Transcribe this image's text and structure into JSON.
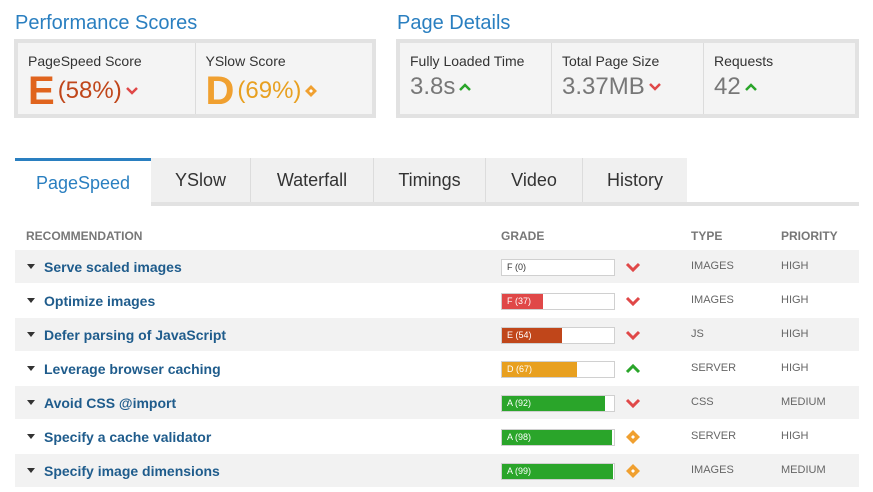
{
  "performance": {
    "title": "Performance Scores",
    "pagespeed": {
      "label": "PageSpeed Score",
      "grade": "E",
      "pct": "(58%)",
      "color": "#e0641e",
      "trend": "down"
    },
    "yslow": {
      "label": "YSlow Score",
      "grade": "D",
      "pct": "(69%)",
      "color": "#f0a030",
      "trend": "neutral"
    }
  },
  "details": {
    "title": "Page Details",
    "load_time": {
      "label": "Fully Loaded Time",
      "value": "3.8s",
      "trend": "up"
    },
    "page_size": {
      "label": "Total Page Size",
      "value": "3.37MB",
      "trend": "down"
    },
    "requests": {
      "label": "Requests",
      "value": "42",
      "trend": "up"
    }
  },
  "tabs": [
    "PageSpeed",
    "YSlow",
    "Waterfall",
    "Timings",
    "Video",
    "History"
  ],
  "active_tab": 0,
  "table": {
    "headers": {
      "recommendation": "RECOMMENDATION",
      "grade": "GRADE",
      "type": "TYPE",
      "priority": "PRIORITY"
    },
    "rows": [
      {
        "name": "Serve scaled images",
        "grade": "F (0)",
        "score": 0,
        "color": "#ffffff",
        "trend": "down",
        "type": "IMAGES",
        "priority": "HIGH"
      },
      {
        "name": "Optimize images",
        "grade": "F (37)",
        "score": 37,
        "color": "#e04848",
        "trend": "down",
        "type": "IMAGES",
        "priority": "HIGH"
      },
      {
        "name": "Defer parsing of JavaScript",
        "grade": "E (54)",
        "score": 54,
        "color": "#c0461a",
        "trend": "down",
        "type": "JS",
        "priority": "HIGH"
      },
      {
        "name": "Leverage browser caching",
        "grade": "D (67)",
        "score": 67,
        "color": "#e8a020",
        "trend": "up",
        "type": "SERVER",
        "priority": "HIGH"
      },
      {
        "name": "Avoid CSS @import",
        "grade": "A (92)",
        "score": 92,
        "color": "#2aa52a",
        "trend": "down",
        "type": "CSS",
        "priority": "MEDIUM"
      },
      {
        "name": "Specify a cache validator",
        "grade": "A (98)",
        "score": 98,
        "color": "#2aa52a",
        "trend": "neutral",
        "type": "SERVER",
        "priority": "HIGH"
      },
      {
        "name": "Specify image dimensions",
        "grade": "A (99)",
        "score": 99,
        "color": "#2aa52a",
        "trend": "neutral",
        "type": "IMAGES",
        "priority": "MEDIUM"
      }
    ]
  },
  "colors": {
    "down": "#e04848",
    "up": "#2aa52a",
    "neutral": "#f0a030",
    "accent": "#2a7fc0"
  }
}
